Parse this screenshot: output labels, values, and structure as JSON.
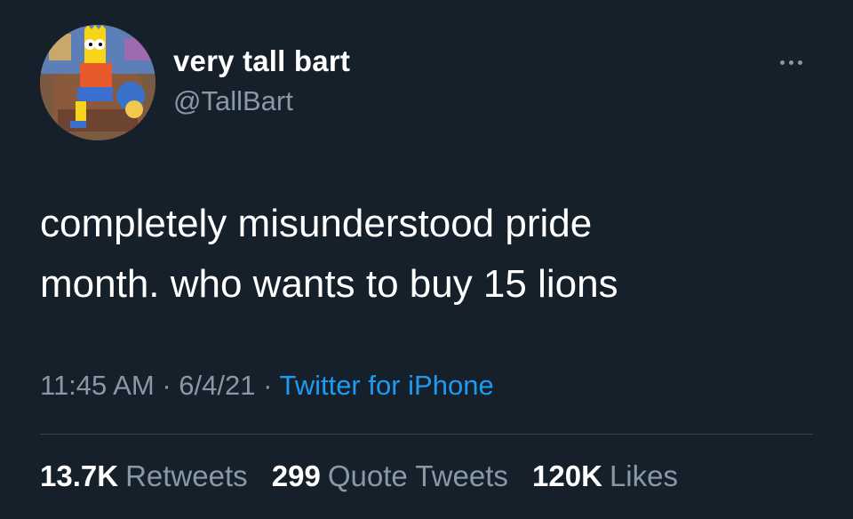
{
  "tweet": {
    "author": {
      "display_name": "very tall bart",
      "handle": "@TallBart",
      "avatar_icon": "bart-simpson-avatar-icon"
    },
    "more_icon": "more-options-icon",
    "text": "completely misunderstood pride\nmonth. who wants to buy 15 lions",
    "time": "11:45 AM",
    "date": "6/4/21",
    "separator": "·",
    "source": "Twitter for iPhone",
    "stats": {
      "retweets_count": "13.7K",
      "retweets_label": "Retweets",
      "quotes_count": "299",
      "quotes_label": "Quote Tweets",
      "likes_count": "120K",
      "likes_label": "Likes"
    }
  },
  "colors": {
    "background": "#15202b",
    "primary_text": "#ffffff",
    "secondary_text": "#8899a6",
    "link": "#1d9bf0",
    "divider": "#38444d"
  }
}
